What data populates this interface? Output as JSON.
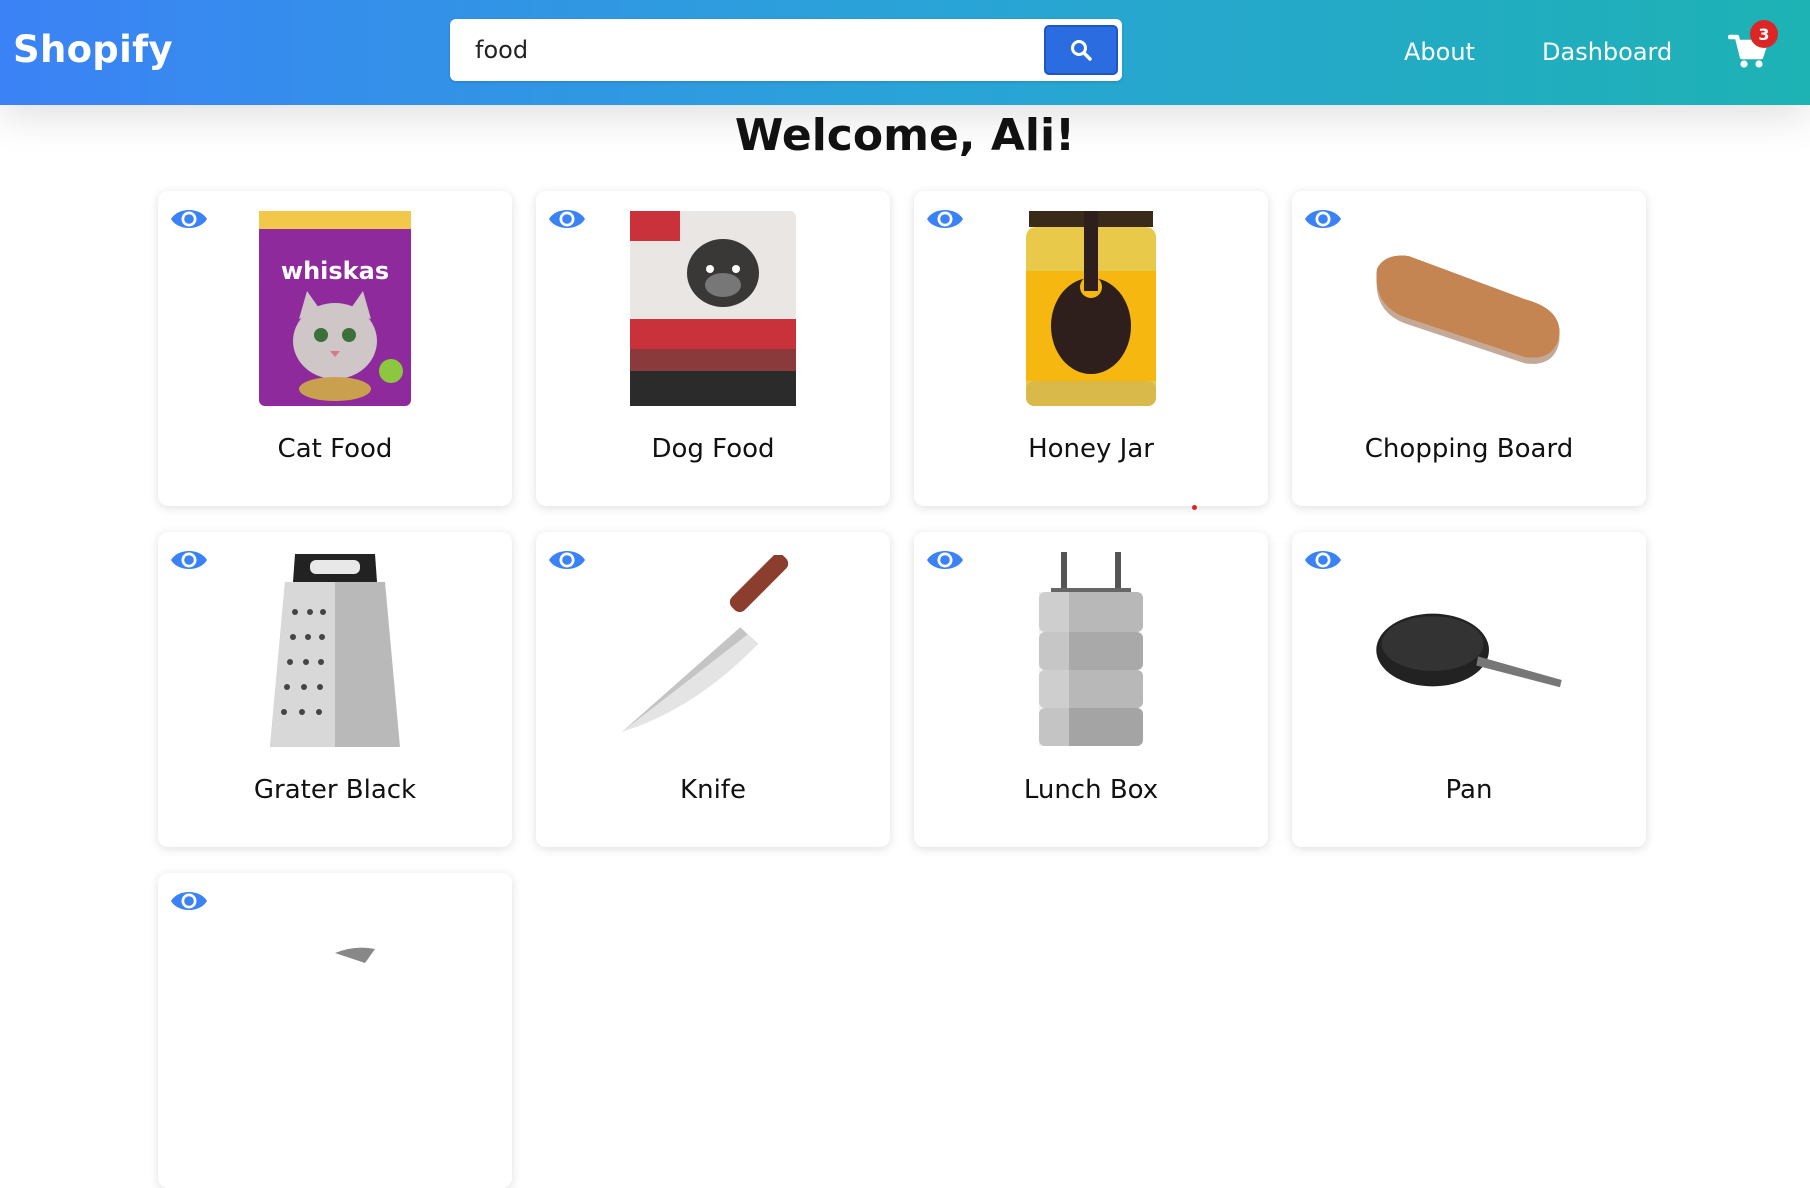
{
  "header": {
    "brand": "Shopify",
    "search_value": "food",
    "nav": {
      "about": "About",
      "dashboard": "Dashboard"
    },
    "cart_count": "3",
    "icons": {
      "search": "search-icon",
      "cart": "cart-icon"
    },
    "colors": {
      "gradient_start": "#3b82f6",
      "gradient_end": "#1db2b4",
      "badge": "#dc2626",
      "accent": "#2b6de0"
    }
  },
  "main": {
    "welcome": "Welcome, Ali!",
    "products": [
      {
        "name": "Cat Food",
        "icon": "cat-food-image"
      },
      {
        "name": "Dog Food",
        "icon": "dog-food-image"
      },
      {
        "name": "Honey Jar",
        "icon": "honey-jar-image"
      },
      {
        "name": "Chopping Board",
        "icon": "chopping-board-image"
      },
      {
        "name": "Grater Black",
        "icon": "grater-image"
      },
      {
        "name": "Knife",
        "icon": "knife-image"
      },
      {
        "name": "Lunch Box",
        "icon": "lunch-box-image"
      },
      {
        "name": "Pan",
        "icon": "pan-image"
      },
      {
        "name": "",
        "icon": "product-image"
      }
    ]
  }
}
